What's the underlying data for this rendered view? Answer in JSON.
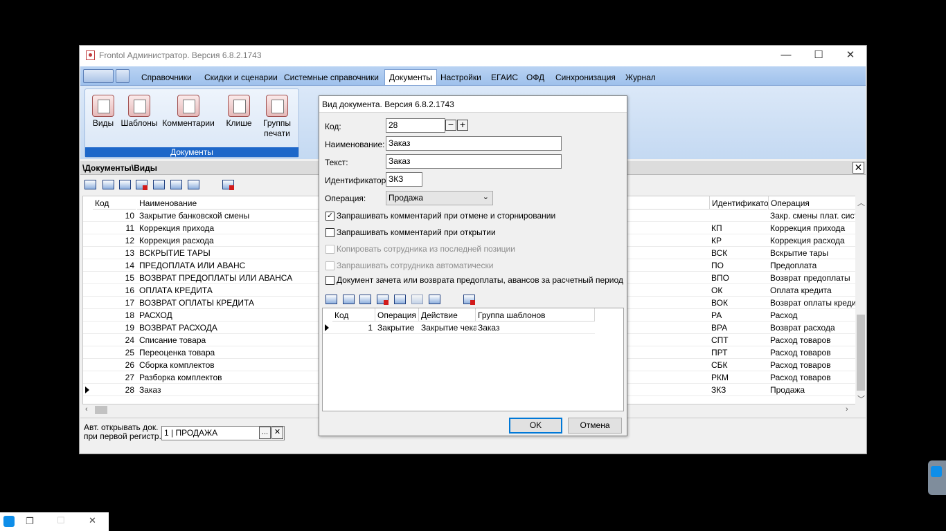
{
  "window": {
    "title": "Frontol Администратор. Версия 6.8.2.1743",
    "controls": {
      "minimize": "—",
      "maximize": "☐",
      "close": "✕"
    }
  },
  "ribbon": {
    "tabs": [
      "Справочники",
      "Скидки и сценарии",
      "Системные справочники",
      "Документы",
      "Настройки",
      "ЕГАИС",
      "ОФД",
      "Синхронизация",
      "Журнал"
    ],
    "active_tab": "Документы",
    "group_caption": "Документы",
    "buttons": [
      {
        "label": "Виды",
        "icon": "document-list-icon"
      },
      {
        "label": "Шаблоны",
        "icon": "template-icon"
      },
      {
        "label": "Комментарии",
        "icon": "comment-icon"
      },
      {
        "label": "Клише",
        "icon": "stamp-icon"
      },
      {
        "label": "Группы\nпечати",
        "icon": "print-group-icon"
      }
    ]
  },
  "path": "\\Документы\\Виды",
  "grid": {
    "columns": {
      "code": "Код",
      "name": "Наименование",
      "id": "Идентификатор",
      "operation": "Операция"
    },
    "rows": [
      {
        "code": "10",
        "name": "Закрытие банковской смены",
        "id": "",
        "operation": "Закр. смены плат. систе"
      },
      {
        "code": "11",
        "name": "Коррекция прихода",
        "id": "КП",
        "operation": "Коррекция прихода"
      },
      {
        "code": "12",
        "name": "Коррекция расхода",
        "id": "КР",
        "operation": "Коррекция расхода"
      },
      {
        "code": "13",
        "name": "ВСКРЫТИЕ ТАРЫ",
        "id": "ВСК",
        "operation": "Вскрытие тары"
      },
      {
        "code": "14",
        "name": "ПРЕДОПЛАТА ИЛИ АВАНС",
        "id": "ПО",
        "operation": "Предоплата"
      },
      {
        "code": "15",
        "name": "ВОЗВРАТ ПРЕДОПЛАТЫ ИЛИ АВАНСА",
        "id": "ВПО",
        "operation": "Возврат предоплаты"
      },
      {
        "code": "16",
        "name": "ОПЛАТА КРЕДИТА",
        "id": "ОК",
        "operation": "Оплата кредита"
      },
      {
        "code": "17",
        "name": "ВОЗВРАТ ОПЛАТЫ КРЕДИТА",
        "id": "ВОК",
        "operation": "Возврат оплаты кредита"
      },
      {
        "code": "18",
        "name": "РАСХОД",
        "id": "РА",
        "operation": "Расход"
      },
      {
        "code": "19",
        "name": "ВОЗВРАТ РАСХОДА",
        "id": "ВРА",
        "operation": "Возврат расхода"
      },
      {
        "code": "24",
        "name": "Списание товара",
        "id": "СПТ",
        "operation": "Расход товаров"
      },
      {
        "code": "25",
        "name": "Переоценка товара",
        "id": "ПРТ",
        "operation": "Расход товаров"
      },
      {
        "code": "26",
        "name": "Сборка комплектов",
        "id": "СБК",
        "operation": "Расход товаров"
      },
      {
        "code": "27",
        "name": "Разборка комплектов",
        "id": "РКМ",
        "operation": "Расход товаров"
      },
      {
        "code": "28",
        "name": "Заказ",
        "id": "ЗКЗ",
        "operation": "Продажа"
      }
    ],
    "selected_row_index": 14
  },
  "bottom": {
    "auto_open_label_1": "Авт. открывать док.",
    "auto_open_label_2": "при первой регистр.:",
    "auto_open_value": "1 | ПРОДАЖА",
    "browse_label": "...",
    "clear_label": "✕"
  },
  "dialog": {
    "title": "Вид документа. Версия 6.8.2.1743",
    "code_label": "Код:",
    "code_value": "28",
    "name_label": "Наименование:",
    "name_value": "Заказ",
    "text_label": "Текст:",
    "text_value": "Заказ",
    "identifier_label": "Идентификатор:",
    "identifier_value": "ЗКЗ",
    "operation_label": "Операция:",
    "operation_value": "Продажа",
    "checkboxes": [
      {
        "label": "Запрашивать комментарий при отмене и сторнировании",
        "checked": true,
        "enabled": true
      },
      {
        "label": "Запрашивать комментарий при открытии",
        "checked": false,
        "enabled": true
      },
      {
        "label": "Копировать сотрудника из последней позиции",
        "checked": false,
        "enabled": false
      },
      {
        "label": "Запрашивать сотрудника автоматически",
        "checked": false,
        "enabled": false
      },
      {
        "label": "Документ зачета или возврата предоплаты, авансов за расчетный период",
        "checked": false,
        "enabled": true
      }
    ],
    "grid_columns": {
      "code": "Код",
      "operation": "Операция",
      "action": "Действие",
      "group": "Группа шаблонов"
    },
    "grid_rows": [
      {
        "code": "1",
        "operation": "Закрытие",
        "action": "Закрытие чека",
        "group": "Заказ"
      }
    ],
    "ok_label": "OK",
    "cancel_label": "Отмена"
  },
  "taskbar": {
    "restore": "❐",
    "maximize": "☐",
    "close": "✕"
  }
}
